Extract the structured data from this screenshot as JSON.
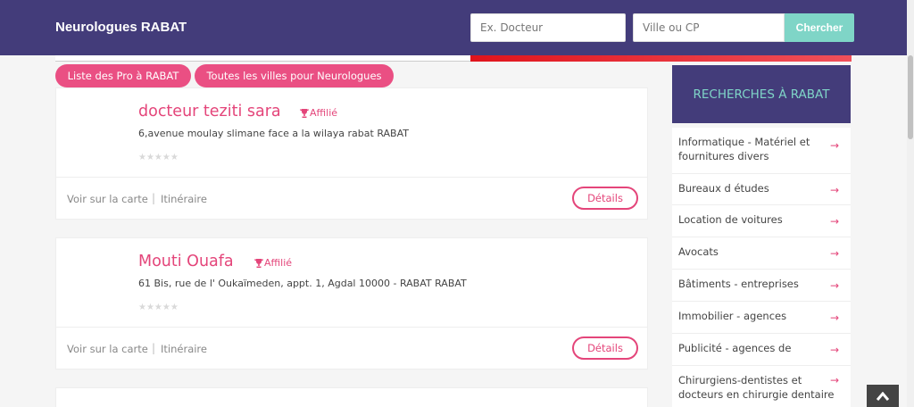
{
  "header": {
    "brand": "Neurologues RABAT",
    "doctor_placeholder": "Ex. Docteur",
    "city_placeholder": "Ville ou CP",
    "search_label": "Chercher"
  },
  "pills": [
    "Liste des Pro à RABAT",
    "Toutes les villes pour Neurologues"
  ],
  "cards": [
    {
      "name": "docteur teziti sara",
      "badge": "Affilié",
      "address": "6,avenue moulay slimane face a la wilaya rabat RABAT",
      "rating_stars": 0,
      "map_link": "Voir sur la carte",
      "separator": "|",
      "route_link": "Itinéraire",
      "details_label": "Détails"
    },
    {
      "name": "Mouti Ouafa",
      "badge": "Affilié",
      "address": "61 Bis, rue de l' Oukaïmeden, appt. 1, Agdal 10000 - RABAT RABAT",
      "rating_stars": 0,
      "map_link": "Voir sur la carte",
      "separator": "|",
      "route_link": "Itinéraire",
      "details_label": "Détails"
    }
  ],
  "stars_glyph": "★★★★★",
  "sidebar": {
    "title": "RECHERCHES À RABAT",
    "arrow": "→",
    "items": [
      "Informatique - Matériel et fournitures divers",
      "Bureaux d études",
      "Location de voitures",
      "Avocats",
      "Bâtiments - entreprises",
      "Immobilier - agences",
      "Publicité - agences de",
      "Chirurgiens-dentistes et docteurs en chirurgie dentaire"
    ]
  },
  "colors": {
    "header_bg": "#433c7a",
    "accent_pink": "#e4457a",
    "pill_pink": "#ea4f83",
    "teal": "#7fd5c7"
  },
  "icons": {
    "badge": "trophy-icon",
    "scroll_top": "chevron-up-icon"
  }
}
